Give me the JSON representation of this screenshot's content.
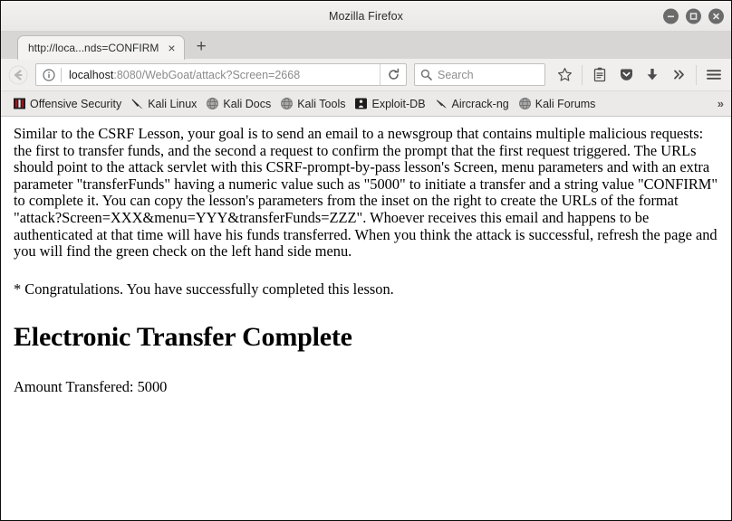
{
  "window": {
    "title": "Mozilla Firefox",
    "controls": [
      {
        "name": "minimize-button",
        "glyph": "minimize"
      },
      {
        "name": "maximize-button",
        "glyph": "maximize"
      },
      {
        "name": "close-button",
        "glyph": "close"
      }
    ]
  },
  "tabs": {
    "active": {
      "title": "http://loca...nds=CONFIRM",
      "close_label": "×"
    },
    "new_tab_label": "+"
  },
  "navbar": {
    "back_icon": "back-arrow-icon",
    "identity_icon": "info-icon",
    "url_host": "localhost",
    "url_path": ":8080/WebGoat/attack?Screen=2668",
    "url_full": "localhost:8080/WebGoat/attack?Screen=2668",
    "reload_icon": "reload-icon",
    "search_placeholder": "Search",
    "search_value": "",
    "buttons": [
      {
        "name": "bookmark-star-button",
        "label": "star-icon"
      },
      {
        "name": "reader-view-button",
        "label": "reader-icon"
      },
      {
        "name": "pocket-button",
        "label": "pocket-icon"
      },
      {
        "name": "downloads-button",
        "label": "download-arrow-icon"
      },
      {
        "name": "overflow-button",
        "label": "»"
      },
      {
        "name": "menu-button",
        "label": "hamburger-icon"
      }
    ]
  },
  "bookmarks": {
    "items": [
      {
        "label": "Offensive Security",
        "icon": "offensive-security-icon"
      },
      {
        "label": "Kali Linux",
        "icon": "kali-dragon-icon"
      },
      {
        "label": "Kali Docs",
        "icon": "globe-icon"
      },
      {
        "label": "Kali Tools",
        "icon": "globe-icon"
      },
      {
        "label": "Exploit-DB",
        "icon": "exploit-db-icon"
      },
      {
        "label": "Aircrack-ng",
        "icon": "aircrack-icon"
      },
      {
        "label": "Kali Forums",
        "icon": "globe-icon"
      }
    ],
    "overflow_label": "»"
  },
  "page": {
    "intro": "Similar to the CSRF Lesson, your goal is to send an email to a newsgroup that contains multiple malicious requests: the first to transfer funds, and the second a request to confirm the prompt that the first request triggered. The URLs should point to the attack servlet with this CSRF-prompt-by-pass lesson's Screen, menu parameters and with an extra parameter \"transferFunds\" having a numeric value such as \"5000\" to initiate a transfer and a string value \"CONFIRM\" to complete it. You can copy the lesson's parameters from the inset on the right to create the URLs of the format \"attack?Screen=XXX&menu=YYY&transferFunds=ZZZ\". Whoever receives this email and happens to be authenticated at that time will have his funds transferred. When you think the attack is successful, refresh the page and you will find the green check on the left hand side menu.",
    "congratulations": "* Congratulations. You have successfully completed this lesson.",
    "heading": "Electronic Transfer Complete",
    "amount_line": "Amount Transfered: 5000"
  },
  "colors": {
    "titlebar_bg": "#eeedec",
    "tabstrip_bg": "#d8d6d4",
    "toolbar_bg": "#f0efee",
    "bookmarks_bg": "#eceae9",
    "content_bg": "#ffffff",
    "text": "#000000",
    "window_border": "#0d0d0d"
  }
}
